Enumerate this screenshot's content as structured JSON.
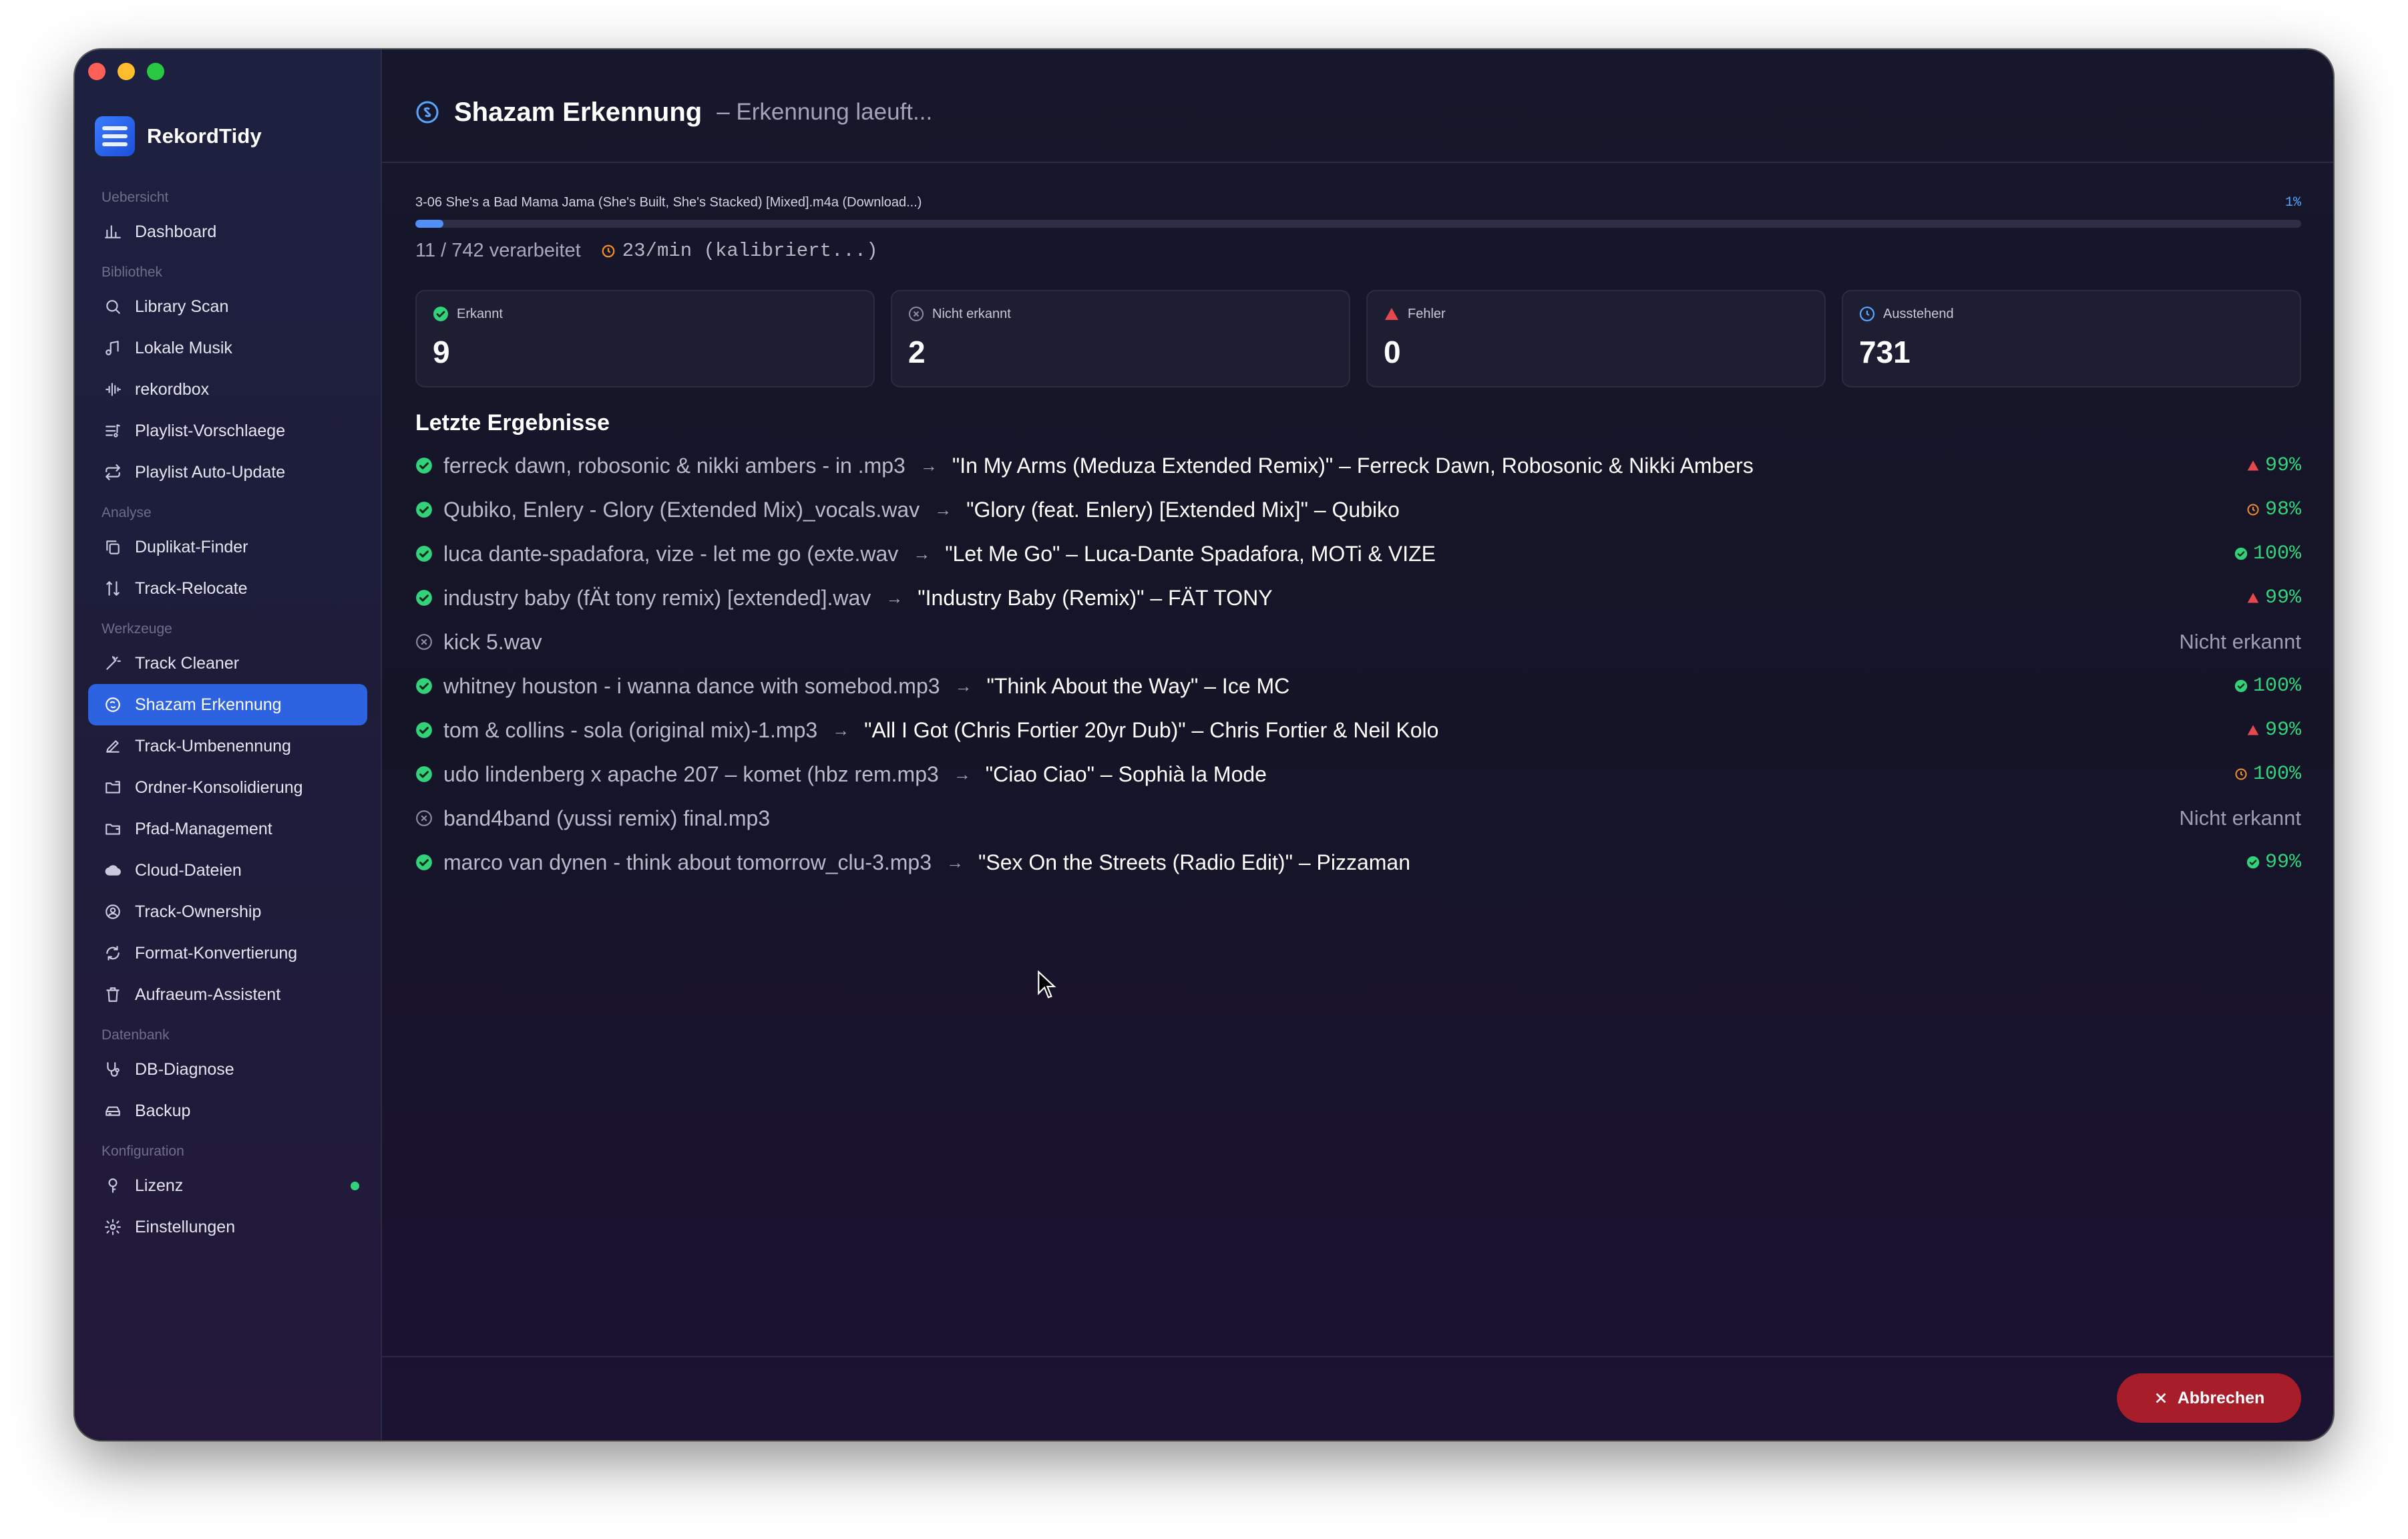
{
  "window": {
    "controls": [
      "close",
      "minimize",
      "zoom"
    ]
  },
  "brand": {
    "name": "RekordTidy"
  },
  "sidebar": {
    "sections": [
      {
        "title": "Uebersicht",
        "items": [
          {
            "label": "Dashboard",
            "icon": "bar-chart-icon"
          }
        ]
      },
      {
        "title": "Bibliothek",
        "items": [
          {
            "label": "Library Scan",
            "icon": "search-icon"
          },
          {
            "label": "Lokale Musik",
            "icon": "music-note-icon"
          },
          {
            "label": "rekordbox",
            "icon": "waveform-icon"
          },
          {
            "label": "Playlist-Vorschlaege",
            "icon": "playlist-icon"
          },
          {
            "label": "Playlist Auto-Update",
            "icon": "repeat-icon"
          }
        ]
      },
      {
        "title": "Analyse",
        "items": [
          {
            "label": "Duplikat-Finder",
            "icon": "duplicate-icon"
          },
          {
            "label": "Track-Relocate",
            "icon": "relocate-icon"
          }
        ]
      },
      {
        "title": "Werkzeuge",
        "items": [
          {
            "label": "Track Cleaner",
            "icon": "magic-wand-icon"
          },
          {
            "label": "Shazam Erkennung",
            "icon": "shazam-icon",
            "active": true
          },
          {
            "label": "Track-Umbenennung",
            "icon": "pencil-icon"
          },
          {
            "label": "Ordner-Konsolidierung",
            "icon": "folder-icon"
          },
          {
            "label": "Pfad-Management",
            "icon": "folder-path-icon"
          },
          {
            "label": "Cloud-Dateien",
            "icon": "cloud-icon"
          },
          {
            "label": "Track-Ownership",
            "icon": "ownership-icon"
          },
          {
            "label": "Format-Konvertierung",
            "icon": "convert-icon"
          },
          {
            "label": "Aufraeum-Assistent",
            "icon": "trash-icon"
          }
        ]
      },
      {
        "title": "Datenbank",
        "items": [
          {
            "label": "DB-Diagnose",
            "icon": "stethoscope-icon"
          },
          {
            "label": "Backup",
            "icon": "backup-icon"
          }
        ]
      },
      {
        "title": "Konfiguration",
        "items": [
          {
            "label": "Lizenz",
            "icon": "key-icon",
            "status_dot": "#33d17a"
          },
          {
            "label": "Einstellungen",
            "icon": "gear-icon"
          }
        ]
      }
    ]
  },
  "header": {
    "title": "Shazam Erkennung",
    "subtitle": "– Erkennung laeuft..."
  },
  "progress": {
    "current_file": "3-06 She's a Bad Mama Jama (She's Built, She's Stacked) [Mixed].m4a (Download...)",
    "percent_label": "1%",
    "fraction": 0.015,
    "processed": "11 / 742 verarbeitet",
    "rate": "23/min (kalibriert...)"
  },
  "cards": [
    {
      "label": "Erkannt",
      "value": "9",
      "icon": "check-circle-icon",
      "color": "#33d17a"
    },
    {
      "label": "Nicht erkannt",
      "value": "2",
      "icon": "x-circle-icon",
      "color": "#9d9db3"
    },
    {
      "label": "Fehler",
      "value": "0",
      "icon": "warning-icon",
      "color": "#e5484d"
    },
    {
      "label": "Ausstehend",
      "value": "731",
      "icon": "clock-icon",
      "color": "#58a6ff"
    }
  ],
  "results": {
    "title": "Letzte Ergebnisse",
    "arrow": "→",
    "rows": [
      {
        "status": "ok",
        "file": "ferreck dawn, robosonic & nikki ambers - in .mp3",
        "match": "\"In My Arms (Meduza Extended Remix)\" – Ferreck Dawn, Robosonic & Nikki Ambers",
        "conf": "99%",
        "conf_icon": "warning"
      },
      {
        "status": "ok",
        "file": "Qubiko, Enlery - Glory (Extended Mix)_vocals.wav",
        "match": "\"Glory (feat. Enlery) [Extended Mix]\" – Qubiko",
        "conf": "98%",
        "conf_icon": "pending"
      },
      {
        "status": "ok",
        "file": "luca dante-spadafora, vize - let me go (exte.wav",
        "match": "\"Let Me Go\" – Luca-Dante Spadafora, MOTi & VIZE",
        "conf": "100%",
        "conf_icon": "ok"
      },
      {
        "status": "ok",
        "file": "industry baby (fÄt tony remix) [extended].wav",
        "match": "\"Industry Baby (Remix)\" – FÄT TONY",
        "conf": "99%",
        "conf_icon": "warning"
      },
      {
        "status": "none",
        "file": "kick 5.wav",
        "match": "",
        "conf": "Nicht erkannt",
        "conf_icon": "none"
      },
      {
        "status": "ok",
        "file": "whitney houston - i wanna dance with somebod.mp3",
        "match": "\"Think About the Way\" – Ice MC",
        "conf": "100%",
        "conf_icon": "ok"
      },
      {
        "status": "ok",
        "file": "tom & collins - sola (original mix)-1.mp3",
        "match": "\"All I Got (Chris Fortier 20yr Dub)\" – Chris Fortier & Neil Kolo",
        "conf": "99%",
        "conf_icon": "warning"
      },
      {
        "status": "ok",
        "file": "udo lindenberg x apache 207 – komet (hbz rem.mp3",
        "match": "\"Ciao Ciao\" – Sophià la Mode",
        "conf": "100%",
        "conf_icon": "pending"
      },
      {
        "status": "none",
        "file": "band4band (yussi remix) final.mp3",
        "match": "",
        "conf": "Nicht erkannt",
        "conf_icon": "none"
      },
      {
        "status": "ok",
        "file": "marco van dynen - think about tomorrow_clu-3.mp3",
        "match": "\"Sex On the Streets (Radio Edit)\" – Pizzaman",
        "conf": "99%",
        "conf_icon": "ok"
      }
    ]
  },
  "footer": {
    "cancel_label": "Abbrechen"
  },
  "colors": {
    "accent": "#2d63e0",
    "ok": "#33d17a",
    "warn": "#e5484d",
    "pending": "#f08c2e",
    "danger_button": "#a71d2a"
  }
}
